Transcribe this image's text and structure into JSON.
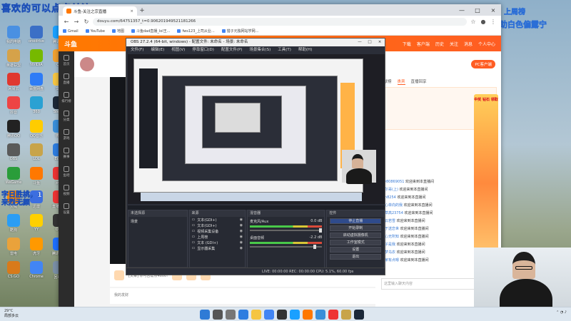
{
  "overlays": {
    "top_banner": "喜欢的可以点点关注",
    "mid_banner": "字日胜桃，1来烈无颜",
    "brand_line1": "上周榜",
    "brand_line2": "助白色偏露宁"
  },
  "desktop_icons": [
    {
      "label": "我的电脑",
      "color": "#4a90e2"
    },
    {
      "label": "onedrive",
      "color": "#3b6fc6"
    },
    {
      "label": "腾讯QQ",
      "color": "#1aa0ff"
    },
    {
      "label": "英雄联盟",
      "color": "#d5a24a"
    },
    {
      "label": "NVIDIA",
      "color": "#76b900"
    },
    {
      "label": "QQ",
      "color": "#f0a030"
    },
    {
      "label": "网易云",
      "color": "#e0382f"
    },
    {
      "label": "百度网盘",
      "color": "#2e7cf6"
    },
    {
      "label": "文件",
      "color": "#f5c542"
    },
    {
      "label": "抖音",
      "color": "#e44"
    },
    {
      "label": "360",
      "color": "#2aa1d3"
    },
    {
      "label": "Steam",
      "color": "#1b2838"
    },
    {
      "label": "腾讯QQ",
      "color": "#222"
    },
    {
      "label": "QQ音乐",
      "color": "#ffcc00"
    },
    {
      "label": "微信",
      "color": "#3a8fd9"
    },
    {
      "label": "OBS",
      "color": "#5a5a5a"
    },
    {
      "label": "LOL",
      "color": "#c8a44a"
    },
    {
      "label": "Edge",
      "color": "#2d7de0"
    },
    {
      "label": "WeGame",
      "color": "#2a9d3a"
    },
    {
      "label": "斗鱼",
      "color": "#ff7800"
    },
    {
      "label": "网易",
      "color": "#e33"
    },
    {
      "label": "火绒",
      "color": "#ff8800"
    },
    {
      "label": "迅雷",
      "color": "#3c6ee0"
    },
    {
      "label": "直播伴侣",
      "color": "#e33"
    },
    {
      "label": "酷狗",
      "color": "#2a9df4"
    },
    {
      "label": "YY",
      "color": "#ffd000"
    },
    {
      "label": "OBS",
      "color": "#333"
    },
    {
      "label": "雷电",
      "color": "#e9a23b"
    },
    {
      "label": "虎牙",
      "color": "#ff9900"
    },
    {
      "label": "腾讯会议",
      "color": "#1e6fff"
    },
    {
      "label": "CS:GO",
      "color": "#d87a1a"
    },
    {
      "label": "Chrome",
      "color": "#4285f4"
    },
    {
      "label": "回收站",
      "color": "#7a8fa6"
    }
  ],
  "browser": {
    "tab_title": "斗鱼-关注之宗直播",
    "tab_close": "×",
    "new_tab": "+",
    "win_min": "—",
    "win_max": "□",
    "win_close": "×",
    "url": "douyu.com/64751357_t=0.906201949521181266",
    "bookmarks": [
      "Gmail",
      "YouTube",
      "地图",
      "斗鱼dad直播_lol王...",
      "fws123_上司从业...",
      "猎子元独网站学网..."
    ]
  },
  "douyu": {
    "logo": "斗鱼",
    "nav": [
      "下载",
      "客户端",
      "历史",
      "关注",
      "消息",
      "个人中心"
    ],
    "left_rail": [
      "首页",
      "直播",
      "排行榜",
      "分类",
      "游戏",
      "赛事",
      "鱼吧",
      "视频",
      "设置"
    ],
    "pc_button": "PC客户端",
    "side_tabs": [
      "贡献榜",
      "贵宾",
      "直播回享"
    ],
    "promo": "中奖\n钻石\n领取",
    "chat": [
      {
        "user": "kw80869051",
        "msg": "欢迎来到本直播间"
      },
      {
        "user": "风尔哥(上)",
        "msg": "欢迎来到本直播间"
      },
      {
        "user": "Wh8254",
        "msg": "欢迎来到本直播间"
      },
      {
        "user": "恋心单向的我",
        "msg": "欢迎来到本直播间"
      },
      {
        "user": "小草高23754",
        "msg": "欢迎来到本直播间"
      },
      {
        "user": "凌云若雪",
        "msg": "欢迎来到本直播间"
      },
      {
        "user": "关于送恋世",
        "msg": "欢迎来到本直播间"
      },
      {
        "user": "开心无所知",
        "msg": "欢迎来到本直播间"
      },
      {
        "user": "关子是我",
        "msg": "欢迎来到本直播间"
      },
      {
        "user": "逐梦乌衣",
        "msg": "欢迎来到本直播间"
      },
      {
        "user": "我家有点嗯",
        "msg": "欢迎来到本直播间"
      }
    ],
    "chat_placeholder": "这里输入聊天内容",
    "send": "发送",
    "gift_text": "[文章] 你可否帮点4600!",
    "under_text": "我的发财"
  },
  "obs": {
    "title": "OBS 27.2.4 (64-bit, windows) - 配置文件: 未命名 - 场景: 未命名",
    "menu": [
      "文件(F)",
      "编辑(E)",
      "视图(V)",
      "停靠窗口(D)",
      "配置文件(P)",
      "场景集合(S)",
      "工具(T)",
      "帮助(H)"
    ],
    "docks": {
      "scenes": "场景",
      "scenes_header": "未选择源",
      "sources_header": "来源",
      "mixer_header": "混音器",
      "transitions_header": "转场特效",
      "controls_header": "控件"
    },
    "scene_name": "场景",
    "sources": [
      "文本(GDI+)",
      "文本(GDI+)",
      "视频采集设备",
      "上周榜",
      "文本 (GDI+)",
      "显示器采集"
    ],
    "mixer": [
      {
        "name": "麦克风/Aux",
        "db": "0.0 dB"
      },
      {
        "name": "桌面音频",
        "db": "-2.2 dB"
      }
    ],
    "controls": [
      "停止直播",
      "开始录制",
      "启动虚拟摄像机",
      "工作室模式",
      "设置",
      "退出"
    ],
    "statusbar": "LIVE: 00:00:00  REC: 00:00:00  CPU: 5.1%, 60.00 fps",
    "win_min": "—",
    "win_max": "□",
    "win_close": "×",
    "tools_glyph": "+ – ⚙ ∧ ∨"
  },
  "taskbar": {
    "temp": "29°C",
    "weather": "局部多云"
  }
}
